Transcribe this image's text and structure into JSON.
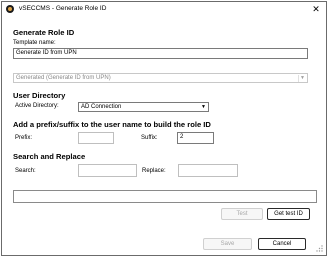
{
  "window": {
    "title": "vSECCMS - Generate Role ID",
    "close_glyph": "✕"
  },
  "generate": {
    "heading": "Generate Role ID",
    "template_label": "Template name:",
    "template_value": "Generate ID from UPN",
    "generated_select": "Generated (Generate ID from UPN)"
  },
  "user_directory": {
    "heading": "User Directory",
    "active_label": "Active Directory:",
    "active_value": "AD Connection"
  },
  "prefix_suffix": {
    "heading": "Add a prefix/suffix to the user name to build the role ID",
    "prefix_label": "Prefix:",
    "prefix_value": "",
    "suffix_label": "Suffix:",
    "suffix_value": "2"
  },
  "search_replace": {
    "heading": "Search and Replace",
    "search_label": "Search:",
    "search_value": "",
    "replace_label": "Replace:",
    "replace_value": ""
  },
  "buttons": {
    "test": "Test",
    "get_test_id": "Get test ID",
    "save": "Save",
    "cancel": "Cancel"
  }
}
